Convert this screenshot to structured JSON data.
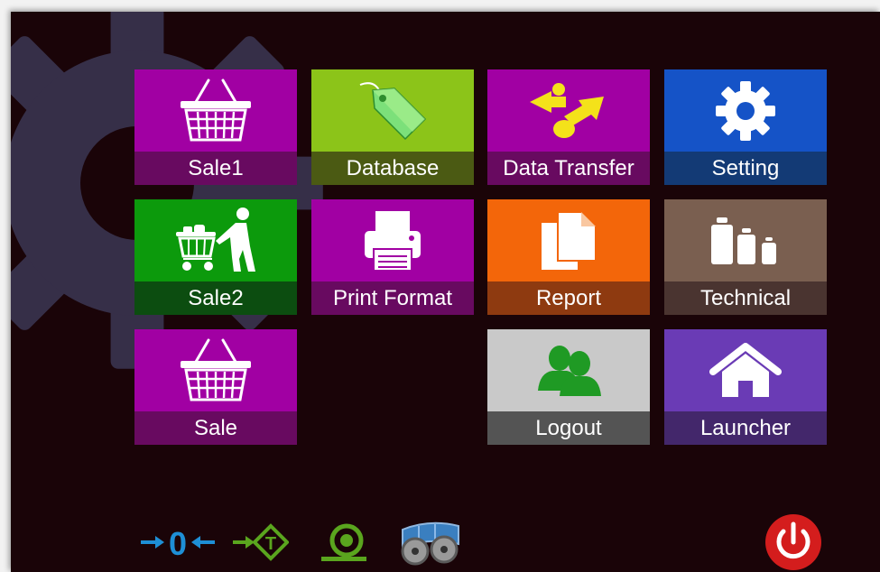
{
  "tiles": [
    {
      "id": "sale1",
      "label": "Sale1",
      "icon": "basket-icon",
      "color": "#a100a3",
      "label_bg": "#680a60"
    },
    {
      "id": "database",
      "label": "Database",
      "icon": "tag-icon",
      "color": "#8cc419",
      "label_bg": "#4b5a13"
    },
    {
      "id": "data-transfer",
      "label": "Data Transfer",
      "icon": "transfer-arrows-icon",
      "color": "#a100a3",
      "label_bg": "#680a60"
    },
    {
      "id": "setting",
      "label": "Setting",
      "icon": "gear-icon",
      "color": "#1553c7",
      "label_bg": "#133a75"
    },
    {
      "id": "sale2",
      "label": "Sale2",
      "icon": "shopper-cart-icon",
      "color": "#0c9a0c",
      "label_bg": "#0c4d10"
    },
    {
      "id": "print-format",
      "label": "Print Format",
      "icon": "printer-icon",
      "color": "#a100a3",
      "label_bg": "#680a60"
    },
    {
      "id": "report",
      "label": "Report",
      "icon": "documents-icon",
      "color": "#f3660a",
      "label_bg": "#8e3a10"
    },
    {
      "id": "technical",
      "label": "Technical",
      "icon": "weights-icon",
      "color": "#7a5f50",
      "label_bg": "#4a3430"
    },
    {
      "id": "sale",
      "label": "Sale",
      "icon": "basket-icon",
      "color": "#a100a3",
      "label_bg": "#680a60"
    },
    {
      "id": "logout",
      "label": "Logout",
      "icon": "users-icon",
      "color": "#c9c9c9",
      "label_bg": "#545454"
    },
    {
      "id": "launcher",
      "label": "Launcher",
      "icon": "home-icon",
      "color": "#6a3bb5",
      "label_bg": "#43276b"
    }
  ],
  "status_icons": [
    {
      "id": "zero",
      "icon": "zero-indicator-icon",
      "text": "0",
      "color": "#1e8fd6"
    },
    {
      "id": "tare",
      "icon": "tare-indicator-icon",
      "text": "T",
      "color": "#5aa51e"
    },
    {
      "id": "paper-roll",
      "icon": "paper-roll-icon",
      "color": "#5aa51e"
    },
    {
      "id": "printer-head",
      "icon": "printer-head-icon",
      "color": "#3a7fc0"
    }
  ],
  "power": {
    "icon": "power-icon",
    "color": "#d41d1d"
  }
}
